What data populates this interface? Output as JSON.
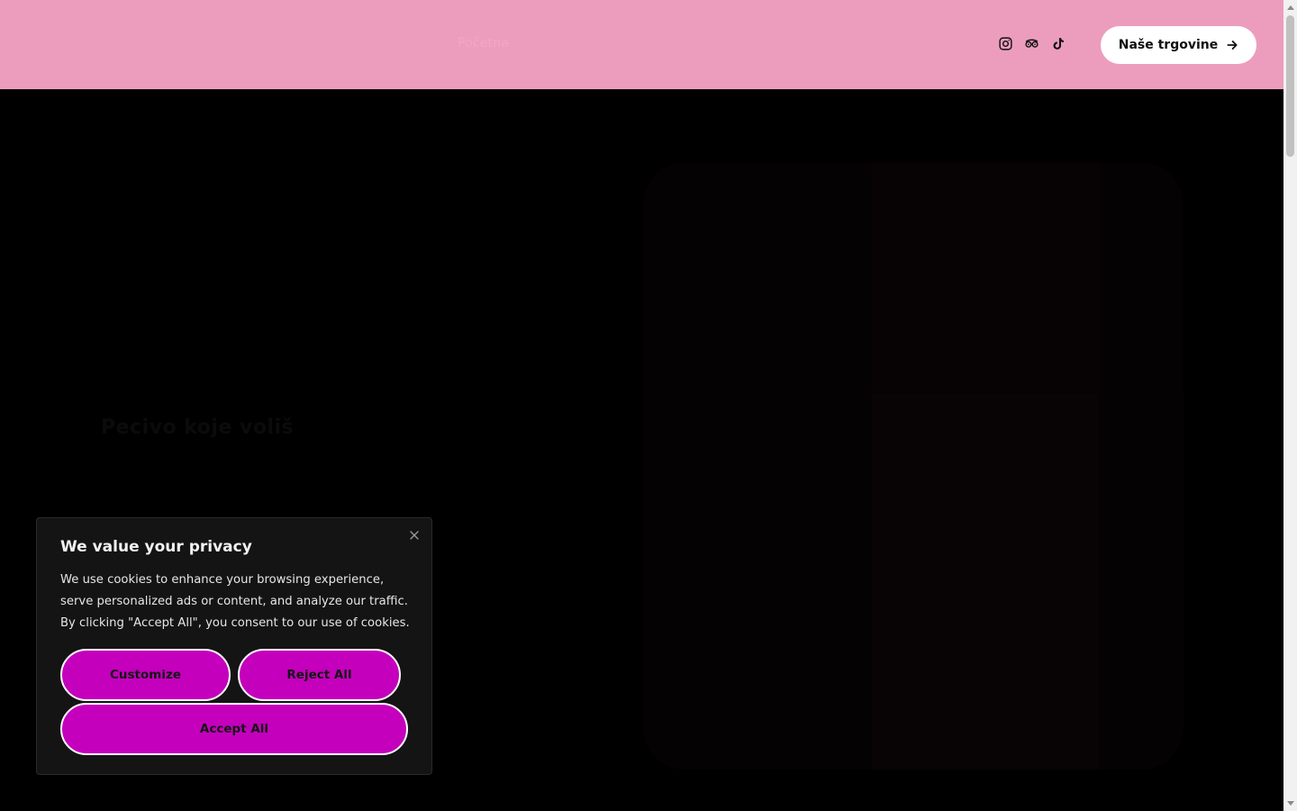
{
  "header": {
    "nav_link": "Početna",
    "social_icons": [
      "instagram-icon",
      "tripadvisor-icon",
      "tiktok-icon"
    ],
    "stores_button_label": "Naše trgovine",
    "background_color": "#ec9dbd"
  },
  "hero": {
    "headline": "Pecivo koje voliš"
  },
  "cookie_banner": {
    "title": "We value your privacy",
    "text": "We use cookies to enhance your browsing experience, serve personalized ads or content, and analyze our traffic. By clicking \"Accept All\", you consent to our use of cookies.",
    "customize_label": "Customize",
    "reject_label": "Reject All",
    "accept_label": "Accept All",
    "button_color": "#c400bc"
  }
}
